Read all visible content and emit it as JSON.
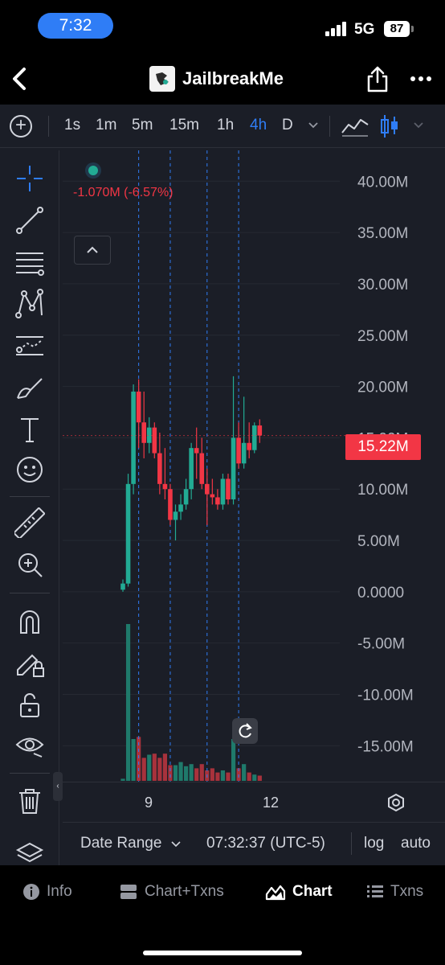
{
  "status_bar": {
    "time": "7:32",
    "network": "5G",
    "battery": "87"
  },
  "nav": {
    "title": "JailbreakMe",
    "icons": [
      "back-chevron-icon",
      "app-logo-icon",
      "share-icon",
      "more-icon"
    ]
  },
  "toolbar": {
    "timeframes": [
      "1s",
      "1m",
      "5m",
      "15m",
      "1h",
      "4h",
      "D"
    ],
    "active_timeframe": "4h",
    "icons": [
      "add-icon",
      "chevron-down-icon",
      "line-chart-icon",
      "candlestick-icon",
      "chevron-down-icon"
    ]
  },
  "tools": [
    "crosshair-icon",
    "trend-line-icon",
    "fib-lines-icon",
    "pattern-icon",
    "forecast-icon",
    "brush-icon",
    "text-icon",
    "emoji-icon",
    "ruler-icon",
    "zoom-in-icon",
    "magnet-icon",
    "lock-draw-icon",
    "unlock-icon",
    "eye-icon",
    "trash-icon",
    "layers-icon"
  ],
  "chart": {
    "change_text": "-1.070M (-6.57%)",
    "current_price": "15.22M",
    "colors": {
      "up": "#22ab94",
      "down": "#f23645",
      "accent": "#2f7df6",
      "background": "#1b1e27"
    }
  },
  "chart_data": {
    "type": "candlestick",
    "y_axis_labels": [
      "40.00M",
      "35.00M",
      "30.00M",
      "25.00M",
      "20.00M",
      "15.00M",
      "10.00M",
      "5.00M",
      "0.0000",
      "-5.00M",
      "-10.00M",
      "-15.00M"
    ],
    "ylim": [
      -18.5,
      43
    ],
    "x_axis_labels": [
      "9",
      "12"
    ],
    "grid": true,
    "candles": [
      {
        "o": 0.2,
        "h": 1.2,
        "l": 0.0,
        "c": 0.8
      },
      {
        "o": 0.8,
        "h": 11.5,
        "l": 0.5,
        "c": 10.5
      },
      {
        "o": 10.5,
        "h": 20.2,
        "l": 9.5,
        "c": 19.5
      },
      {
        "o": 19.5,
        "h": 20.7,
        "l": 14.0,
        "c": 16.5
      },
      {
        "o": 16.5,
        "h": 19.5,
        "l": 13.0,
        "c": 14.5
      },
      {
        "o": 14.5,
        "h": 17.0,
        "l": 13.5,
        "c": 16.0
      },
      {
        "o": 16.0,
        "h": 16.5,
        "l": 13.0,
        "c": 13.5
      },
      {
        "o": 13.5,
        "h": 15.5,
        "l": 9.5,
        "c": 10.5
      },
      {
        "o": 10.5,
        "h": 14.0,
        "l": 9.0,
        "c": 10.0
      },
      {
        "o": 10.0,
        "h": 10.5,
        "l": 6.5,
        "c": 7.0
      },
      {
        "o": 7.0,
        "h": 8.5,
        "l": 5.0,
        "c": 7.8
      },
      {
        "o": 7.8,
        "h": 9.5,
        "l": 7.0,
        "c": 8.5
      },
      {
        "o": 8.5,
        "h": 11.0,
        "l": 8.0,
        "c": 10.0
      },
      {
        "o": 10.0,
        "h": 14.5,
        "l": 9.0,
        "c": 14.0
      },
      {
        "o": 14.0,
        "h": 16.0,
        "l": 11.0,
        "c": 13.5
      },
      {
        "o": 13.5,
        "h": 15.0,
        "l": 10.0,
        "c": 10.5
      },
      {
        "o": 10.5,
        "h": 12.0,
        "l": 6.5,
        "c": 9.5
      },
      {
        "o": 9.5,
        "h": 11.0,
        "l": 8.5,
        "c": 9.2
      },
      {
        "o": 9.2,
        "h": 10.0,
        "l": 8.0,
        "c": 8.5
      },
      {
        "o": 8.5,
        "h": 11.5,
        "l": 8.0,
        "c": 11.0
      },
      {
        "o": 11.0,
        "h": 11.5,
        "l": 8.5,
        "c": 9.0
      },
      {
        "o": 9.0,
        "h": 21.0,
        "l": 8.5,
        "c": 15.0
      },
      {
        "o": 15.0,
        "h": 16.5,
        "l": 12.0,
        "c": 12.5
      },
      {
        "o": 12.5,
        "h": 19.0,
        "l": 12.0,
        "c": 14.5
      },
      {
        "o": 14.5,
        "h": 16.5,
        "l": 13.0,
        "c": 13.8
      },
      {
        "o": 13.8,
        "h": 16.5,
        "l": 13.5,
        "c": 16.2
      },
      {
        "o": 16.2,
        "h": 16.8,
        "l": 14.5,
        "c": 15.22
      }
    ],
    "volume": [
      2,
      150,
      40,
      42,
      22,
      25,
      26,
      22,
      26,
      15,
      15,
      18,
      14,
      16,
      12,
      16,
      10,
      12,
      8,
      10,
      8,
      40,
      12,
      16,
      8,
      6,
      5
    ],
    "vertical_markers_candle_index": [
      3,
      9,
      16,
      22
    ]
  },
  "time_axis": {
    "labels": [
      "9",
      "12"
    ]
  },
  "range_bar": {
    "date_range": "Date Range",
    "clock": "07:32:37 (UTC-5)",
    "log": "log",
    "auto": "auto"
  },
  "bottom_nav": {
    "tabs": [
      "Info",
      "Chart+Txns",
      "Chart",
      "Txns"
    ],
    "active": "Chart"
  }
}
